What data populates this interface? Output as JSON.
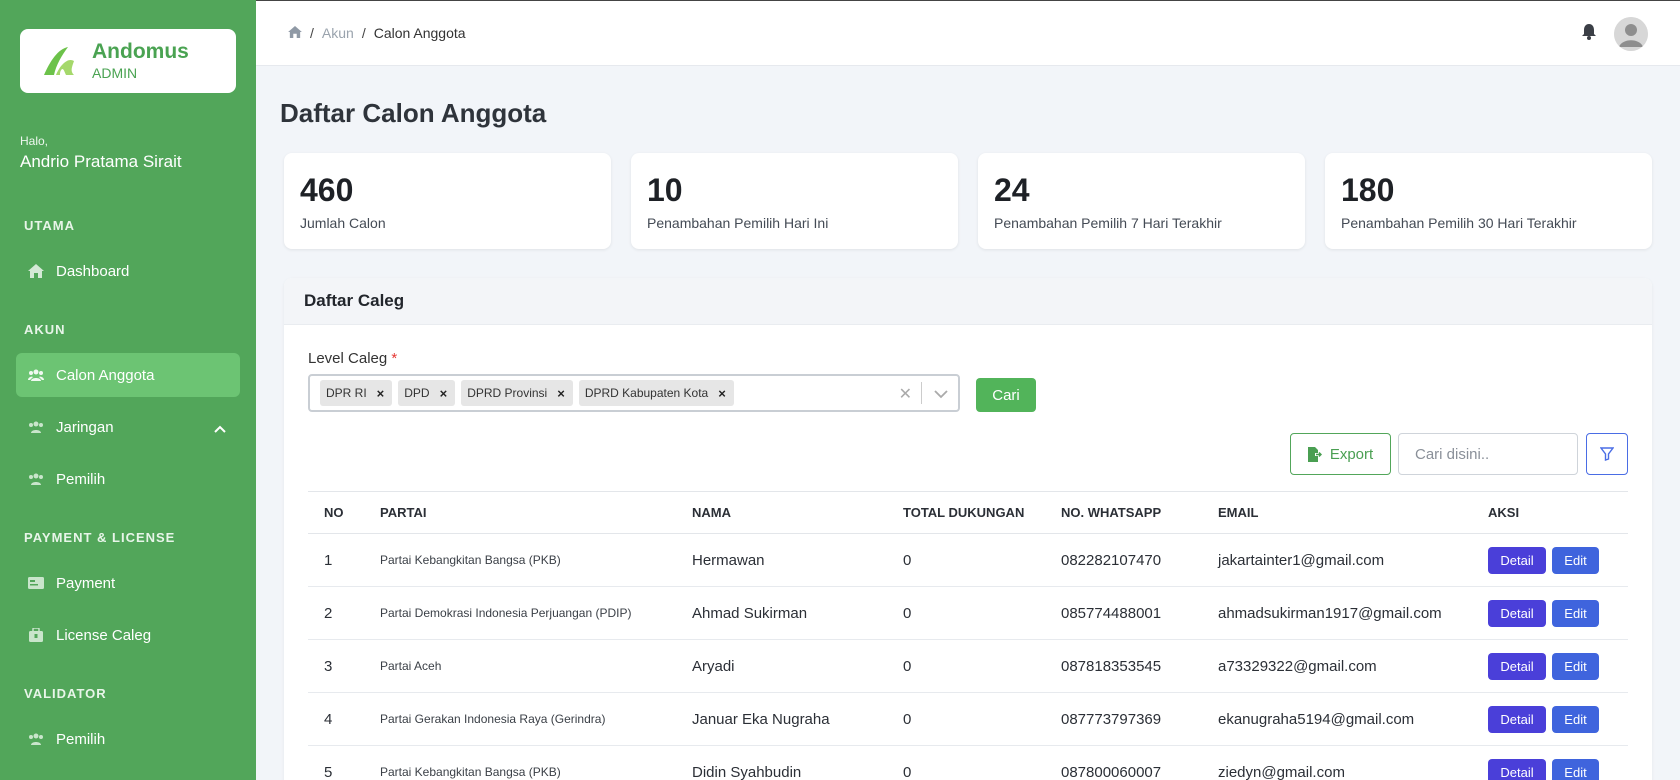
{
  "brand": {
    "name": "Andomus",
    "role": "ADMIN"
  },
  "user": {
    "greeting": "Halo,",
    "name": "Andrio Pratama Sirait"
  },
  "sidebar": {
    "sections": [
      {
        "title": "UTAMA"
      },
      {
        "title": "AKUN"
      },
      {
        "title": "PAYMENT & LICENSE"
      },
      {
        "title": "VALIDATOR"
      }
    ],
    "items": [
      {
        "label": "Dashboard"
      },
      {
        "label": "Calon Anggota"
      },
      {
        "label": "Jaringan"
      },
      {
        "label": "Pemilih"
      },
      {
        "label": "Payment"
      },
      {
        "label": "License Caleg"
      },
      {
        "label": "Pemilih"
      }
    ]
  },
  "breadcrumb": {
    "level1": "Akun",
    "level2": "Calon Anggota"
  },
  "page": {
    "title": "Daftar Calon Anggota"
  },
  "stats": [
    {
      "value": "460",
      "label": "Jumlah Calon"
    },
    {
      "value": "10",
      "label": "Penambahan Pemilih Hari Ini"
    },
    {
      "value": "24",
      "label": "Penambahan Pemilih 7 Hari Terakhir"
    },
    {
      "value": "180",
      "label": "Penambahan Pemilih 30 Hari Terakhir"
    }
  ],
  "panel": {
    "title": "Daftar Caleg",
    "level_label": "Level Caleg",
    "required_mark": "*",
    "tags": [
      "DPR RI",
      "DPD",
      "DPRD Provinsi",
      "DPRD Kabupaten Kota"
    ],
    "search_button": "Cari",
    "export_button": "Export",
    "search_placeholder": "Cari disini.."
  },
  "table": {
    "headers": [
      "NO",
      "PARTAI",
      "NAMA",
      "TOTAL DUKUNGAN",
      "NO. WHATSAPP",
      "EMAIL",
      "AKSI"
    ],
    "detail_label": "Detail",
    "edit_label": "Edit",
    "rows": [
      {
        "no": "1",
        "partai": "Partai Kebangkitan Bangsa (PKB)",
        "nama": "Hermawan",
        "dukungan": "0",
        "wa": "082282107470",
        "email": "jakartainter1@gmail.com"
      },
      {
        "no": "2",
        "partai": "Partai Demokrasi Indonesia Perjuangan (PDIP)",
        "nama": "Ahmad Sukirman",
        "dukungan": "0",
        "wa": "085774488001",
        "email": "ahmadsukirman1917@gmail.com"
      },
      {
        "no": "3",
        "partai": "Partai Aceh",
        "nama": "Aryadi",
        "dukungan": "0",
        "wa": "087818353545",
        "email": "a73329322@gmail.com"
      },
      {
        "no": "4",
        "partai": "Partai Gerakan Indonesia Raya (Gerindra)",
        "nama": "Januar Eka Nugraha",
        "dukungan": "0",
        "wa": "087773797369",
        "email": "ekanugraha5194@gmail.com"
      },
      {
        "no": "5",
        "partai": "Partai Kebangkitan Bangsa (PKB)",
        "nama": "Didin Syahbudin",
        "dukungan": "0",
        "wa": "087800060007",
        "email": "ziedyn@gmail.com"
      }
    ]
  }
}
